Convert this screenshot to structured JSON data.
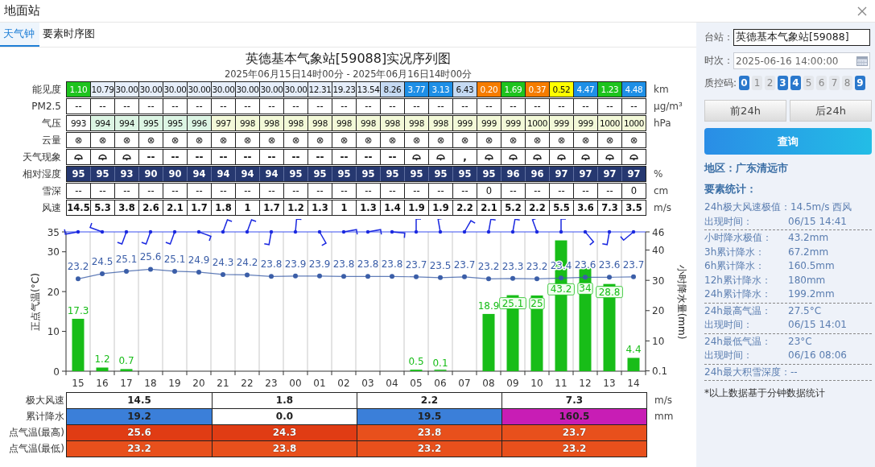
{
  "window": {
    "title": "地面站"
  },
  "tabs": [
    {
      "label": "天气钟",
      "selected": true
    },
    {
      "label": "要素时序图",
      "selected": false
    }
  ],
  "title": "英德基本气象站[59088]实况序列图",
  "subtitle": "2025年06月15日14时00分 - 2025年06月16日14时00分",
  "table": {
    "rows": [
      {
        "label": "能见度",
        "unit": "km",
        "kind": "colored",
        "cells": [
          {
            "text": "1.10",
            "color": "#1ec31e"
          },
          {
            "text": "10.79",
            "color": "#e6eefa"
          },
          {
            "text": "30.00",
            "color": "#e6eefa"
          },
          {
            "text": "30.00",
            "color": "#e6eefa"
          },
          {
            "text": "30.00",
            "color": "#e6eefa"
          },
          {
            "text": "30.00",
            "color": "#e6eefa"
          },
          {
            "text": "30.00",
            "color": "#e6eefa"
          },
          {
            "text": "30.00",
            "color": "#e6eefa"
          },
          {
            "text": "30.00",
            "color": "#e6eefa"
          },
          {
            "text": "30.00",
            "color": "#e6eefa"
          },
          {
            "text": "12.31",
            "color": "#e6eefa"
          },
          {
            "text": "19.23",
            "color": "#e6eefa"
          },
          {
            "text": "13.54",
            "color": "#e6eefa"
          },
          {
            "text": "8.26",
            "color": "#c5daf3"
          },
          {
            "text": "3.77",
            "color": "#1e8fe6"
          },
          {
            "text": "3.13",
            "color": "#1e8fe6"
          },
          {
            "text": "6.43",
            "color": "#c5daf3"
          },
          {
            "text": "0.20",
            "color": "#f57c00"
          },
          {
            "text": "1.69",
            "color": "#1ec31e"
          },
          {
            "text": "0.37",
            "color": "#f57c00"
          },
          {
            "text": "0.52",
            "color": "#ffff00"
          },
          {
            "text": "4.47",
            "color": "#1e8fe6"
          },
          {
            "text": "1.23",
            "color": "#1ec31e"
          },
          {
            "text": "4.48",
            "color": "#1e8fe6"
          }
        ]
      },
      {
        "label": "PM2.5",
        "unit": "μg/m³",
        "kind": "plain",
        "cells": [
          "--",
          "--",
          "--",
          "--",
          "--",
          "--",
          "--",
          "--",
          "--",
          "--",
          "--",
          "--",
          "--",
          "--",
          "--",
          "--",
          "--",
          "--",
          "--",
          "--",
          "--",
          "--",
          "--",
          "--"
        ]
      },
      {
        "label": "气压",
        "unit": "hPa",
        "kind": "colored",
        "cells": [
          {
            "text": "993",
            "color": "#ffffff"
          },
          {
            "text": "994",
            "color": "#dcf5e4"
          },
          {
            "text": "994",
            "color": "#dcf5e4"
          },
          {
            "text": "995",
            "color": "#dcf5e4"
          },
          {
            "text": "995",
            "color": "#dcf5e4"
          },
          {
            "text": "996",
            "color": "#dcf5e4"
          },
          {
            "text": "997",
            "color": "#f3f9d8"
          },
          {
            "text": "998",
            "color": "#f3f9d8"
          },
          {
            "text": "998",
            "color": "#f3f9d8"
          },
          {
            "text": "998",
            "color": "#f3f9d8"
          },
          {
            "text": "998",
            "color": "#f3f9d8"
          },
          {
            "text": "998",
            "color": "#f3f9d8"
          },
          {
            "text": "998",
            "color": "#f3f9d8"
          },
          {
            "text": "998",
            "color": "#f3f9d8"
          },
          {
            "text": "998",
            "color": "#f3f9d8"
          },
          {
            "text": "998",
            "color": "#f3f9d8"
          },
          {
            "text": "999",
            "color": "#f3f9d8"
          },
          {
            "text": "999",
            "color": "#f3f9d8"
          },
          {
            "text": "999",
            "color": "#f3f9d8"
          },
          {
            "text": "1000",
            "color": "#f3f9d8"
          },
          {
            "text": "999",
            "color": "#f3f9d8"
          },
          {
            "text": "999",
            "color": "#f3f9d8"
          },
          {
            "text": "1000",
            "color": "#f3f9d8"
          },
          {
            "text": "1000",
            "color": "#f3f9d8"
          }
        ]
      },
      {
        "label": "云量",
        "kind": "plain",
        "cells": [
          "⊗",
          "⊗",
          "⊗",
          "⊗",
          "⊗",
          "⊗",
          "⊗",
          "⊗",
          "⊗",
          "⊗",
          "⊗",
          "⊗",
          "⊗",
          "⊗",
          "⊗",
          "⊗",
          "⊗",
          "⊗",
          "⊗",
          "⊗",
          "⊗",
          "⊗",
          "⊗",
          "⊗"
        ]
      },
      {
        "label": "天气现象",
        "kind": "weather",
        "cells": [
          {
            "kind": "shower"
          },
          {
            "kind": "shower"
          },
          {
            "kind": "shower"
          },
          {
            "kind": "text",
            "text": "--"
          },
          {
            "kind": "text",
            "text": "--"
          },
          {
            "kind": "text",
            "text": "--"
          },
          {
            "kind": "text",
            "text": "--"
          },
          {
            "kind": "text",
            "text": "--"
          },
          {
            "kind": "text",
            "text": "--"
          },
          {
            "kind": "text",
            "text": "--"
          },
          {
            "kind": "text",
            "text": "--"
          },
          {
            "kind": "text",
            "text": "--"
          },
          {
            "kind": "text",
            "text": "--"
          },
          {
            "kind": "text",
            "text": "--"
          },
          {
            "kind": "shower"
          },
          {
            "kind": "shower"
          },
          {
            "kind": "text",
            "text": ","
          },
          {
            "kind": "shower"
          },
          {
            "kind": "shower"
          },
          {
            "kind": "shower"
          },
          {
            "kind": "shower"
          },
          {
            "kind": "shower"
          },
          {
            "kind": "shower"
          },
          {
            "kind": "shower"
          }
        ]
      },
      {
        "label": "相对湿度",
        "unit": "%",
        "kind": "dark",
        "cells": [
          "95",
          "95",
          "93",
          "90",
          "90",
          "94",
          "94",
          "94",
          "94",
          "95",
          "95",
          "95",
          "95",
          "95",
          "95",
          "95",
          "95",
          "95",
          "96",
          "96",
          "97",
          "97",
          "97",
          "97"
        ]
      },
      {
        "label": "雪深",
        "unit": "cm",
        "kind": "plain",
        "cells": [
          "--",
          "--",
          "--",
          "--",
          "--",
          "--",
          "--",
          "--",
          "--",
          "--",
          "--",
          "--",
          "--",
          "--",
          "--",
          "--",
          "--",
          "0",
          "--",
          "--",
          "--",
          "--",
          "--",
          "0"
        ]
      },
      {
        "label": "风速",
        "unit": "m/s",
        "kind": "bold",
        "cells": [
          "14.5",
          "5.3",
          "3.8",
          "2.6",
          "2.1",
          "1.7",
          "1.8",
          "1",
          "1.7",
          "1.2",
          "1.3",
          "1",
          "1.3",
          "1.4",
          "1.9",
          "1.9",
          "2.2",
          "2.1",
          "5.2",
          "2.2",
          "5.5",
          "3.6",
          "7.3",
          "3.5"
        ]
      }
    ]
  },
  "chart": {
    "chart_data": {
      "type": "bar",
      "categories": [
        "15",
        "16",
        "17",
        "18",
        "19",
        "20",
        "21",
        "22",
        "23",
        "00",
        "01",
        "02",
        "03",
        "04",
        "05",
        "06",
        "07",
        "08",
        "09",
        "10",
        "11",
        "12",
        "13",
        "14"
      ],
      "ylabel": "正点气温(°C)",
      "y2label": "小时降水量(mm)",
      "ylim": [
        0,
        35
      ],
      "yticks": [
        0,
        10,
        20,
        30,
        35
      ],
      "y2lim": [
        0,
        46
      ],
      "y2ticks": [
        0.1,
        10,
        20,
        30,
        40,
        46
      ],
      "data_labels": true,
      "series": [
        {
          "color": "#18bd18",
          "axis": "y2",
          "values": [
            17.3,
            1.2,
            0.7,
            null,
            null,
            null,
            null,
            null,
            null,
            null,
            null,
            null,
            null,
            null,
            0.5,
            0.1,
            null,
            18.9,
            25.1,
            25,
            43.2,
            34,
            28.8,
            4.4
          ]
        },
        {
          "color": "#3b5ea8",
          "type": "line",
          "marker": "circle",
          "values": [
            23.2,
            24.5,
            25.1,
            25.6,
            25.1,
            24.9,
            24.3,
            24.2,
            23.8,
            23.9,
            23.9,
            23.8,
            23.8,
            23.8,
            23.7,
            23.5,
            23.7,
            23.2,
            23.3,
            23.2,
            23.4,
            23.6,
            23.6,
            23.7
          ]
        }
      ]
    }
  },
  "summary": {
    "rows": [
      {
        "label": "极大风速",
        "unit": "m/s",
        "kind": "dark-text",
        "cells": [
          {
            "text": "14.5",
            "color": "#ffffff"
          },
          {
            "text": "1.8",
            "color": "#ffffff"
          },
          {
            "text": "2.2",
            "color": "#ffffff"
          },
          {
            "text": "7.3",
            "color": "#ffffff"
          }
        ]
      },
      {
        "label": "累计降水",
        "unit": "mm",
        "kind": "dark-text",
        "cells": [
          {
            "text": "19.2",
            "color": "#3b7fd9"
          },
          {
            "text": "0.0",
            "color": "#ffffff"
          },
          {
            "text": "19.5",
            "color": "#3b7fd9"
          },
          {
            "text": "160.5",
            "color": "#c81db5"
          }
        ]
      },
      {
        "label": "点气温(最高)",
        "kind": "light-text",
        "cells": [
          {
            "text": "25.6",
            "color": "#e03c14"
          },
          {
            "text": "24.3",
            "color": "#e03c14"
          },
          {
            "text": "23.8",
            "color": "#e8501c"
          },
          {
            "text": "23.7",
            "color": "#e8501c"
          }
        ]
      },
      {
        "label": "点气温(最低)",
        "kind": "light-text",
        "cells": [
          {
            "text": "23.2",
            "color": "#e8501c"
          },
          {
            "text": "23.8",
            "color": "#e8501c"
          },
          {
            "text": "23.2",
            "color": "#e8501c"
          },
          {
            "text": "23.2",
            "color": "#e8501c"
          }
        ]
      }
    ]
  },
  "side": {
    "station": {
      "label": "台站：",
      "value": "英德基本气象站[59088]"
    },
    "time": {
      "label": "时次：",
      "value": "2025-06-16 14:00:00"
    },
    "qc": {
      "label": "质控码:",
      "codes": [
        {
          "text": "0",
          "selected": true
        },
        {
          "text": "1",
          "selected": false
        },
        {
          "text": "2",
          "selected": false
        },
        {
          "text": "3",
          "selected": true
        },
        {
          "text": "4",
          "selected": true
        },
        {
          "text": "5",
          "selected": false
        },
        {
          "text": "6",
          "selected": false
        },
        {
          "text": "7",
          "selected": false
        },
        {
          "text": "8",
          "selected": false
        },
        {
          "text": "9",
          "selected": true
        }
      ]
    },
    "buttons": [
      "前24h",
      "后24h"
    ],
    "query_button": "查询",
    "region": "地区：广东清远市",
    "stats_title": "要素统计：",
    "stat_groups": [
      [
        {
          "label": "24h极大风速极值：",
          "value": "14.5m/s 西风"
        },
        {
          "label": "出现时间：",
          "value": "06/15 14:41"
        }
      ],
      [
        {
          "label": "小时降水极值：",
          "value": "43.2mm"
        },
        {
          "label": "3h累计降水：",
          "value": "67.2mm"
        },
        {
          "label": "6h累计降水：",
          "value": "160.5mm"
        },
        {
          "label": "12h累计降水：",
          "value": "180mm"
        },
        {
          "label": "24h累计降水：",
          "value": "199.2mm"
        }
      ],
      [
        {
          "label": "24h最高气温：",
          "value": "27.5°C"
        },
        {
          "label": "出现时间：",
          "value": "06/15 14:01"
        }
      ],
      [
        {
          "label": "24h最低气温：",
          "value": "23°C"
        },
        {
          "label": "出现时间：",
          "value": "06/16 08:06"
        }
      ],
      [
        {
          "label": "24h最大积雪深度：",
          "value": "--"
        }
      ]
    ],
    "note": "*以上数据基于分钟数据统计"
  }
}
